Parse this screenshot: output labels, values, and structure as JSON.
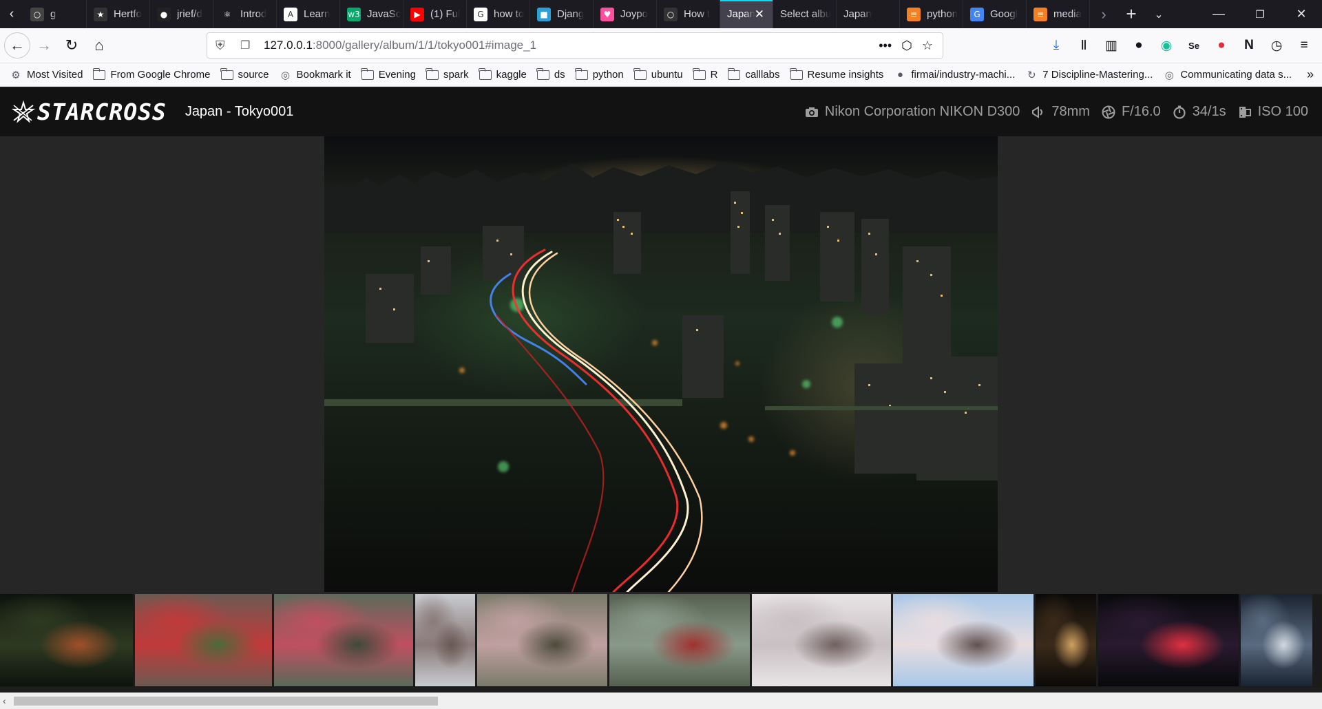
{
  "browser": {
    "tabs": [
      {
        "label": "g",
        "favicon": "generic-icon",
        "color": "#444"
      },
      {
        "label": "Hertfo",
        "favicon": "star-logo-icon",
        "color": "#333"
      },
      {
        "label": "jrief/d",
        "favicon": "github-icon",
        "color": "#222"
      },
      {
        "label": "Introd",
        "favicon": "react-icon",
        "color": "#1c1b22"
      },
      {
        "label": "Learn",
        "favicon": "angular-icon",
        "color": "#fff"
      },
      {
        "label": "JavaSc",
        "favicon": "w3schools-icon",
        "color": "#04aa6d"
      },
      {
        "label": "(1) Ful",
        "favicon": "youtube-icon",
        "color": "#ff0000"
      },
      {
        "label": "how to",
        "favicon": "google-icon",
        "color": "#fff"
      },
      {
        "label": "Djang",
        "favicon": "django-icon",
        "color": "#2ba0d8"
      },
      {
        "label": "Joypo",
        "favicon": "heart-icon",
        "color": "#ff4fa0"
      },
      {
        "label": "How t",
        "favicon": "generic-icon",
        "color": "#333"
      },
      {
        "label": "Japan -",
        "favicon": "",
        "color": "#42414d",
        "active": true
      },
      {
        "label": "Select albu",
        "favicon": "",
        "color": "#1c1b22"
      },
      {
        "label": "Japan",
        "favicon": "",
        "color": "#1c1b22"
      },
      {
        "label": "python",
        "favicon": "stackoverflow-icon",
        "color": "#f48024"
      },
      {
        "label": "Googl",
        "favicon": "google-translate-icon",
        "color": "#4285f4"
      },
      {
        "label": "media",
        "favicon": "stackoverflow-icon",
        "color": "#f48024"
      }
    ],
    "url": {
      "host": "127.0.0.1",
      "rest": ":8000/gallery/album/1/1/tokyo001#image_1"
    },
    "bookmarks": [
      {
        "label": "Most Visited",
        "icon": "gear-icon"
      },
      {
        "label": "From Google Chrome",
        "icon": "folder-icon"
      },
      {
        "label": "source",
        "icon": "folder-icon"
      },
      {
        "label": "Bookmark it",
        "icon": "globe-icon"
      },
      {
        "label": "Evening",
        "icon": "folder-icon"
      },
      {
        "label": "spark",
        "icon": "folder-icon"
      },
      {
        "label": "kaggle",
        "icon": "folder-icon"
      },
      {
        "label": "ds",
        "icon": "folder-icon"
      },
      {
        "label": "python",
        "icon": "folder-icon"
      },
      {
        "label": "ubuntu",
        "icon": "folder-icon"
      },
      {
        "label": "R",
        "icon": "folder-icon"
      },
      {
        "label": "calllabs",
        "icon": "folder-icon"
      },
      {
        "label": "Resume insights",
        "icon": "folder-icon"
      },
      {
        "label": "firmai/industry-machi...",
        "icon": "github-icon"
      },
      {
        "label": "7 Discipline-Mastering...",
        "icon": "loop-icon"
      },
      {
        "label": "Communicating data s...",
        "icon": "globe-icon"
      }
    ]
  },
  "app": {
    "logo_text": "STARCROSS",
    "album_title": "Japan - Tokyo001",
    "exif": {
      "camera": "Nikon Corporation NIKON D300",
      "focal_length": "78mm",
      "aperture": "F/16.0",
      "shutter": "34/1s",
      "iso": "ISO 100"
    },
    "thumbnails": [
      {
        "name": "thumb-night-city",
        "colors": [
          "#0d120d",
          "#2e3a22",
          "#a0502a"
        ]
      },
      {
        "name": "thumb-jizo-statues",
        "colors": [
          "#6b5a52",
          "#c23a3a",
          "#4b6a3a"
        ]
      },
      {
        "name": "thumb-buddha-statue",
        "colors": [
          "#5a6a5a",
          "#c05060",
          "#3d4a3a"
        ]
      },
      {
        "name": "thumb-tokyo-tower",
        "colors": [
          "#c9ccd0",
          "#8a7a7a",
          "#6a5a55"
        ]
      },
      {
        "name": "thumb-festival-stalls",
        "colors": [
          "#7a7a6a",
          "#c0a0a0",
          "#4a4a3a"
        ]
      },
      {
        "name": "thumb-garden-shrine",
        "colors": [
          "#556050",
          "#8a9a8a",
          "#a03030"
        ]
      },
      {
        "name": "thumb-cherry-blossoms",
        "colors": [
          "#e8e4e6",
          "#c8c0c2",
          "#706060"
        ]
      },
      {
        "name": "thumb-bird-blossom",
        "colors": [
          "#a8c8e8",
          "#e8dde0",
          "#605050"
        ]
      },
      {
        "name": "thumb-night-street",
        "colors": [
          "#0a0908",
          "#3a2a1a",
          "#d0a060"
        ]
      },
      {
        "name": "thumb-shinjuku-night",
        "colors": [
          "#07090b",
          "#2a1a30",
          "#e03040"
        ]
      },
      {
        "name": "thumb-city-traffic",
        "colors": [
          "#1a2330",
          "#5a6a80",
          "#d0d8e0"
        ]
      }
    ]
  }
}
